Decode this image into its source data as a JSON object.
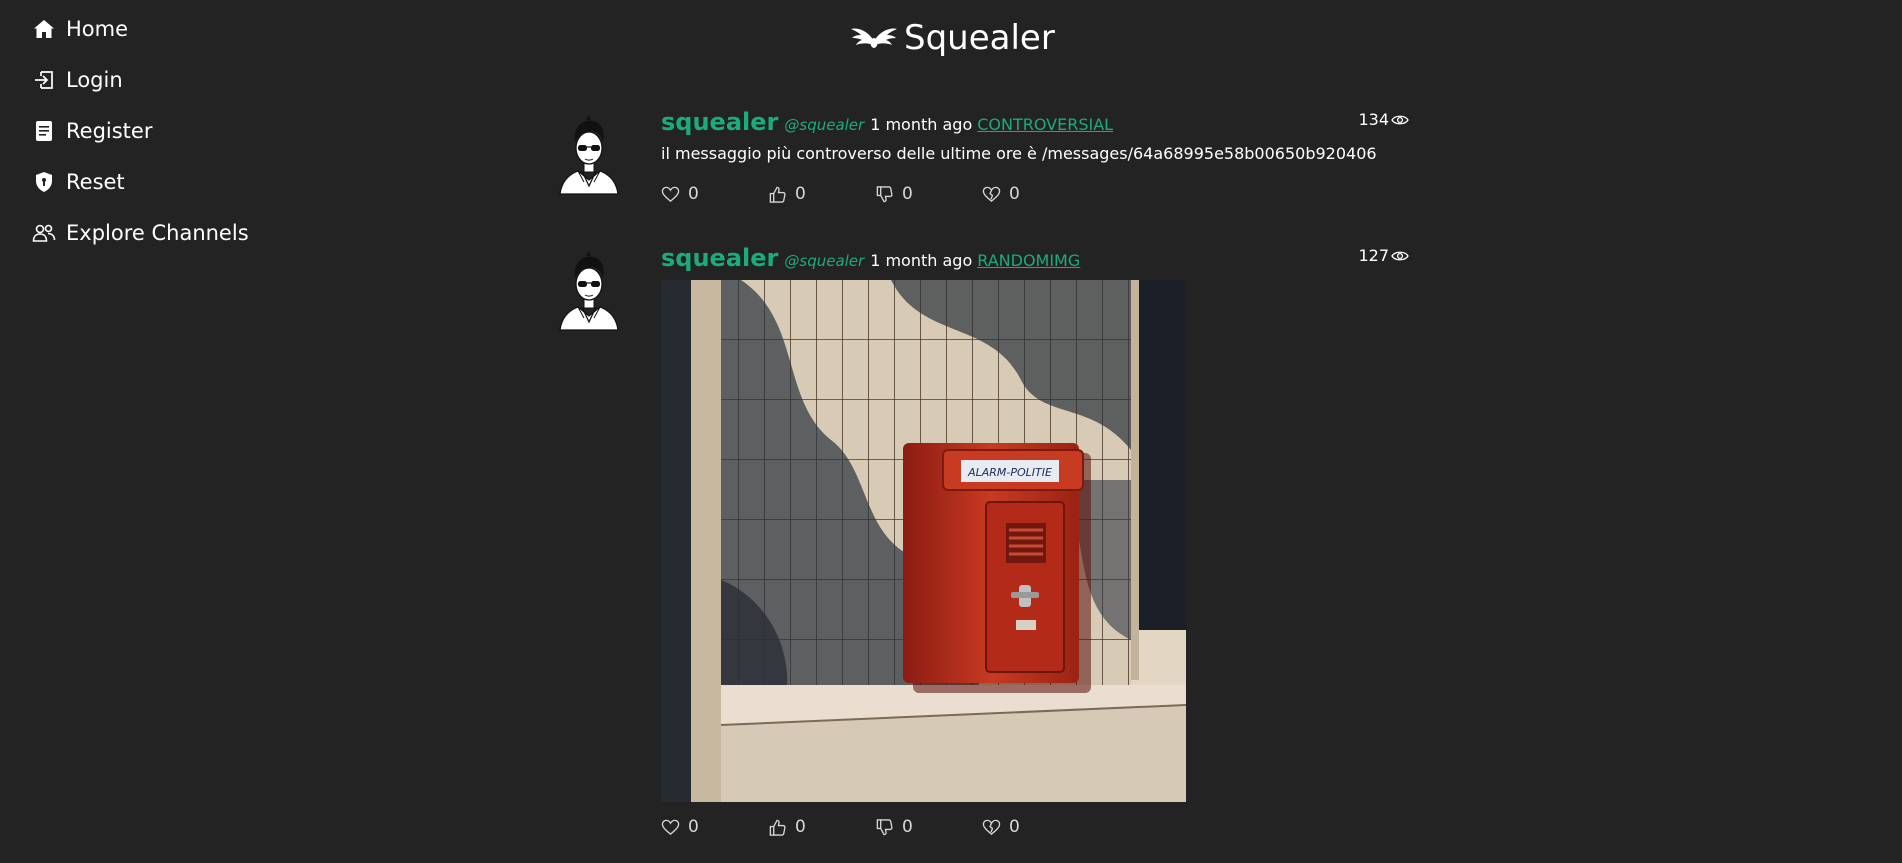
{
  "sidebar": {
    "items": [
      {
        "label": "Home",
        "icon": "home-icon"
      },
      {
        "label": "Login",
        "icon": "login-icon"
      },
      {
        "label": "Register",
        "icon": "register-icon"
      },
      {
        "label": "Reset",
        "icon": "shield-icon"
      },
      {
        "label": "Explore Channels",
        "icon": "people-icon"
      }
    ]
  },
  "header": {
    "title": "Squealer",
    "logo_icon": "wings-icon"
  },
  "colors": {
    "background": "#232323",
    "accent": "#1cab7d",
    "text": "#ffffff",
    "alarm_red": "#b8281c"
  },
  "posts": [
    {
      "author": "squealer",
      "handle": "@squealer",
      "time": "1 month ago",
      "channel": "CONTROVERSIAL",
      "views": "134",
      "text": "il messaggio più controverso delle ultime ore è /messages/64a68995e58b00650b920406",
      "reactions": {
        "like": "0",
        "thumbs_up": "0",
        "thumbs_down": "0",
        "broken_heart": "0"
      }
    },
    {
      "author": "squealer",
      "handle": "@squealer",
      "time": "1 month ago",
      "channel": "RANDOMIMG",
      "views": "127",
      "image_sign_text": "ALARM-POLITIE",
      "reactions": {
        "like": "0",
        "thumbs_up": "0",
        "thumbs_down": "0",
        "broken_heart": "0"
      }
    }
  ]
}
